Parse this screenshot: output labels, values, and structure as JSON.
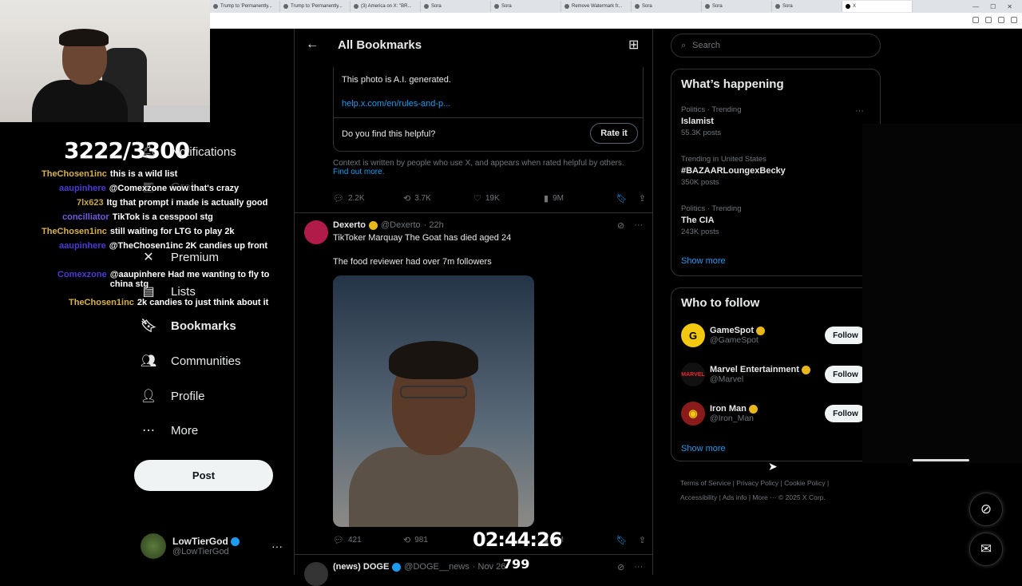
{
  "browser": {
    "tabs": [
      "Trump to 'Permanently...",
      "Trump to 'Permanently...",
      "(3) America on X: \"BR...",
      "Sora",
      "Sora",
      "Remove Watermark fr...",
      "Sora",
      "Sora",
      "Sora",
      "X"
    ]
  },
  "stream": {
    "counter": "3222/3300",
    "timer": "02:44:26",
    "viewers": "799",
    "chat": [
      {
        "name": "TheChosen1inc",
        "msg": "this is a wild list"
      },
      {
        "name": "aaupinhere",
        "msg": "@Comexzone wow that's crazy"
      },
      {
        "name": "7lx623",
        "msg": "Itg that prompt i made is actually good"
      },
      {
        "name": "concilliator",
        "msg": "TikTok is a cesspool stg"
      },
      {
        "name": "TheChosen1inc",
        "msg": "still waiting for LTG to play 2k"
      },
      {
        "name": "aaupinhere",
        "msg": "@TheChosen1inc 2K candies up front"
      },
      {
        "name": "Comexzone",
        "msg": "@aaupinhere Had me wanting to fly to china stg"
      },
      {
        "name": "TheChosen1inc",
        "msg": "2k candies to just think about it"
      }
    ]
  },
  "nav": {
    "notifications": "Notifications",
    "grok": "Grok",
    "premium": "Premium",
    "lists": "Lists",
    "bookmarks": "Bookmarks",
    "communities": "Communities",
    "profile": "Profile",
    "more": "More",
    "post": "Post"
  },
  "account": {
    "name": "LowTierGod",
    "handle": "@LowTierGod"
  },
  "main": {
    "title": "All Bookmarks",
    "note": {
      "text": "This photo is A.I. generated.",
      "link": "help.x.com/en/rules-and-p...",
      "question": "Do you find this helpful?",
      "rate": "Rate it",
      "context": "Context is written by people who use X, and appears when rated helpful by others.",
      "find_out": "Find out more."
    },
    "actions1": {
      "replies": "2.2K",
      "reposts": "3.7K",
      "likes": "19K",
      "views": "9M"
    },
    "tweet": {
      "name": "Dexerto",
      "handle": "@Dexerto",
      "time": "· 22h",
      "line1": "TikToker Marquay The Goat has died aged 24",
      "line2": "The food reviewer had over 7m followers"
    },
    "actions2": {
      "replies": "421",
      "reposts": "981",
      "views": "2M"
    },
    "tweet3": {
      "name": "(news) DOGE",
      "handle": "@DOGE__news",
      "time": "· Nov 26"
    }
  },
  "sidebar": {
    "search_placeholder": "Search",
    "happening_title": "What’s happening",
    "trends": [
      {
        "meta": "Politics · Trending",
        "name": "Islamist",
        "count": "55.3K posts"
      },
      {
        "meta": "Trending in United States",
        "name": "#BAZAARLoungexBecky",
        "count": "350K posts"
      },
      {
        "meta": "Politics · Trending",
        "name": "The CIA",
        "count": "243K posts"
      }
    ],
    "show_more": "Show more",
    "wtf_title": "Who to follow",
    "follow": [
      {
        "name": "GameSpot",
        "handle": "@GameSpot",
        "btn": "Follow"
      },
      {
        "name": "Marvel Entertainment",
        "handle": "@Marvel",
        "btn": "Follow"
      },
      {
        "name": "Iron Man",
        "handle": "@Iron_Man",
        "btn": "Follow"
      }
    ],
    "footer": [
      "Terms of Service",
      "Privacy Policy",
      "Cookie Policy",
      "Accessibility",
      "Ads info",
      "More ···",
      "© 2025 X Corp."
    ]
  },
  "colors": {
    "accent": "#1d9bf0",
    "bg": "#000000",
    "border": "#2f3336",
    "muted": "#71767b"
  }
}
